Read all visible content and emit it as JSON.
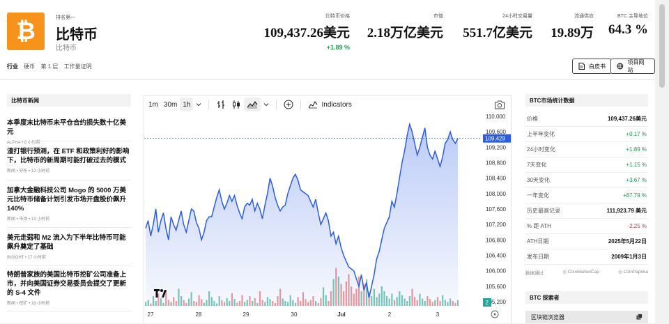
{
  "header": {
    "rank": "排名第一",
    "name": "比特币",
    "subname": "比特币",
    "logo_symbol": "₿",
    "logo_color": "#f7931a"
  },
  "stats": [
    {
      "label": "比特币价格",
      "value": "109,437.26美元",
      "change": "+1.89 %"
    },
    {
      "label": "市值",
      "value": "2.18万亿美元"
    },
    {
      "label": "24小时交易量",
      "value": "551.7亿美元"
    },
    {
      "label": "流通供应",
      "value": "19.89万"
    },
    {
      "label": "BTC 主导地位",
      "value": "64.3 %"
    }
  ],
  "tags": {
    "industry": "行业",
    "items": [
      "硬币",
      "第 1 层",
      "工作量证明"
    ]
  },
  "buttons": {
    "whitepaper": "白皮书",
    "website": "项目网站"
  },
  "news": {
    "header": "比特币新闻",
    "items": [
      {
        "title": "本季度末比特币未平仓合约损失数十亿美元",
        "meta": "ALPHA  •  8 小时前"
      },
      {
        "title": "渣打银行预测，在 ETF 和政策利好的影响下，比特币的新周期可能打破过去的模式",
        "meta": "新闻  •  分析  •  12 小时前"
      },
      {
        "title": "加拿大金融科技公司 Mogo 的 5000 万美元比特币储备计划引发市场开盘股价飙升 140%",
        "meta": "新闻  •  市场  •  13 小时前"
      },
      {
        "title": "美元走弱和 M2 流入为下半年比特币可能飙升奠定了基础",
        "meta": "INSIGHT  •  17 小时前"
      },
      {
        "title": "特朗普家族的美国比特币挖矿公司准备上市，并向美国证券交易委员会提交了更新的 S-4 文件",
        "meta": "新闻  •  挖矿  •  18 小时前"
      }
    ]
  },
  "toolbar": {
    "intervals": [
      "1m",
      "30m",
      "1h"
    ],
    "active_interval": "1h",
    "indicators": "Indicators"
  },
  "chart_data": {
    "type": "area",
    "x_labels": [
      "27",
      "28",
      "29",
      "30",
      "Jul",
      "2",
      "3"
    ],
    "y_ticks": [
      110000,
      109600,
      109200,
      108800,
      108400,
      108000,
      107600,
      107200,
      106800,
      106400,
      106000,
      105600,
      105200
    ],
    "ylim": [
      105200,
      110000
    ],
    "current_price_label": "109,429",
    "current_price": 109429,
    "volume_badge": "2",
    "series": [
      {
        "values": [
          107100,
          107300,
          106900,
          107200,
          107600,
          107000,
          107300,
          107500,
          107100,
          106800,
          107400,
          107200,
          107050,
          107300,
          107550,
          107200,
          107000,
          107300,
          107600,
          107550,
          107250,
          107100,
          106800,
          107000,
          107300,
          107400,
          107400,
          107650,
          107900,
          108100,
          107800,
          107600,
          107750,
          107950,
          107800,
          107950,
          107700,
          107500,
          107350,
          107650,
          107750,
          107700,
          107850,
          107550,
          107750,
          107600,
          107350,
          107700,
          108000,
          108400,
          108200,
          107900,
          107700,
          107550,
          107650,
          107700,
          108000,
          108200,
          108400,
          108500,
          108350,
          108100,
          108050,
          108000,
          107950,
          107800,
          107650,
          107850,
          107500,
          107200,
          107350,
          107500,
          107300,
          106900,
          107000,
          106700,
          106900,
          106600,
          106400,
          106250,
          106100,
          106050,
          106000,
          105800,
          105600,
          105900,
          105500,
          105700,
          105300,
          105600,
          105900,
          106300,
          106500,
          106800,
          107100,
          107250,
          107400,
          107800,
          107650,
          108000,
          108400,
          108800,
          109100,
          109500,
          109800,
          109600,
          109300,
          109000,
          109200,
          109450,
          109700,
          109200,
          109000,
          108900,
          109100,
          108900,
          108700,
          108950,
          109300,
          109400,
          109600,
          109400,
          109300,
          109429
        ]
      }
    ],
    "volume": [
      0.08,
      0.12,
      0.05,
      0.2,
      0.1,
      0.25,
      0.15,
      0.06,
      0.3,
      0.12,
      0.08,
      0.18,
      0.1,
      0.35,
      0.2,
      0.12,
      0.06,
      0.15,
      0.28,
      0.1,
      0.08,
      0.22,
      0.14,
      0.06,
      0.12,
      0.3,
      0.18,
      0.1,
      0.05,
      0.2,
      0.12,
      0.08,
      0.16,
      0.1,
      0.26,
      0.14,
      0.06,
      0.1,
      0.22,
      0.08,
      0.12,
      0.2,
      0.1,
      0.16,
      0.06,
      0.3,
      0.12,
      0.08,
      0.18,
      0.14,
      0.1,
      0.06,
      0.2,
      0.35,
      0.15,
      0.1,
      0.08,
      0.22,
      0.12,
      0.06,
      0.18,
      0.1,
      0.28,
      0.14,
      0.08,
      0.12,
      0.2,
      0.1,
      0.06,
      0.16,
      0.38,
      0.22,
      0.1,
      0.3,
      0.55,
      0.78,
      0.6,
      0.45,
      0.3,
      0.5,
      0.65,
      0.4,
      0.25,
      0.35,
      0.6,
      0.3,
      0.45,
      0.55,
      0.28,
      0.2,
      0.35,
      0.18,
      0.25,
      0.4,
      0.3,
      0.2,
      0.15,
      0.25,
      0.12,
      0.18,
      0.3,
      0.22,
      0.15,
      0.1,
      0.2,
      0.35,
      0.18,
      0.12,
      0.25,
      0.15,
      0.1,
      0.2,
      0.14,
      0.08,
      0.12,
      0.18,
      0.1,
      0.22,
      0.12,
      0.08,
      0.15,
      0.1,
      0.06,
      0.12
    ]
  },
  "right_stats": {
    "header": "BTC市场统计数据",
    "rows": [
      {
        "k": "价格",
        "v": "109,437.26美元",
        "cls": ""
      },
      {
        "k": "上半年变化",
        "v": "+0.17 %",
        "cls": "pos"
      },
      {
        "k": "24小时变化",
        "v": "+1.89 %",
        "cls": "pos"
      },
      {
        "k": "7天变化",
        "v": "+1.15 %",
        "cls": "pos"
      },
      {
        "k": "30天变化",
        "v": "+3.67 %",
        "cls": "pos"
      },
      {
        "k": "一年变化",
        "v": "+87.79 %",
        "cls": "pos"
      },
      {
        "k": "历史最高记录",
        "v": "111,923.79 美元",
        "cls": ""
      },
      {
        "k": "% 距 ATH",
        "v": "-2.25 %",
        "cls": "neg"
      },
      {
        "k": "ATH日期",
        "v": "2025年5月22日",
        "cls": ""
      },
      {
        "k": "发布日期",
        "v": "2009年1月3日",
        "cls": ""
      }
    ],
    "source_label": "数据通过",
    "sources": [
      "CoinMarketCap",
      "CoinPaprika"
    ],
    "explorer_header": "BTC 探索者",
    "explorer_item": "区块链浏览器"
  },
  "colors": {
    "accent_green": "#1b9a4b",
    "accent_red": "#d23a3a",
    "line_blue": "#2b5ce6",
    "volume_green": "#79c9b5",
    "volume_red": "#ef9a9a"
  }
}
